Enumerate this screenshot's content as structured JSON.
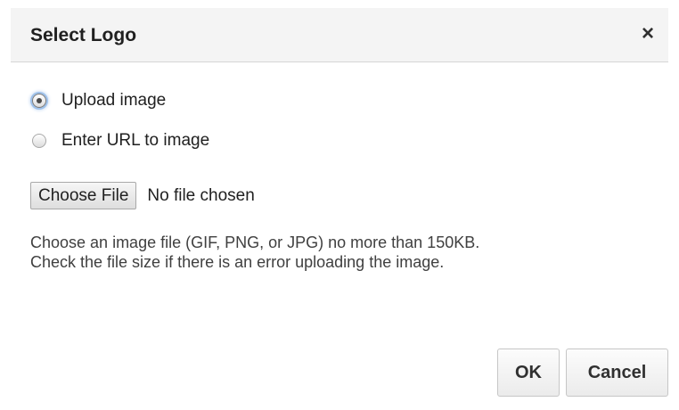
{
  "dialog": {
    "title": "Select Logo",
    "close_icon": "×"
  },
  "options": [
    {
      "label": "Upload image",
      "selected": true
    },
    {
      "label": "Enter URL to image",
      "selected": false
    }
  ],
  "file_input": {
    "button_label": "Choose File",
    "status": "No file chosen"
  },
  "help": {
    "line1": "Choose an image file (GIF, PNG, or JPG) no more than 150KB.",
    "line2": "Check the file size if there is an error uploading the image."
  },
  "buttons": {
    "ok_label": "OK",
    "cancel_label": "Cancel"
  }
}
